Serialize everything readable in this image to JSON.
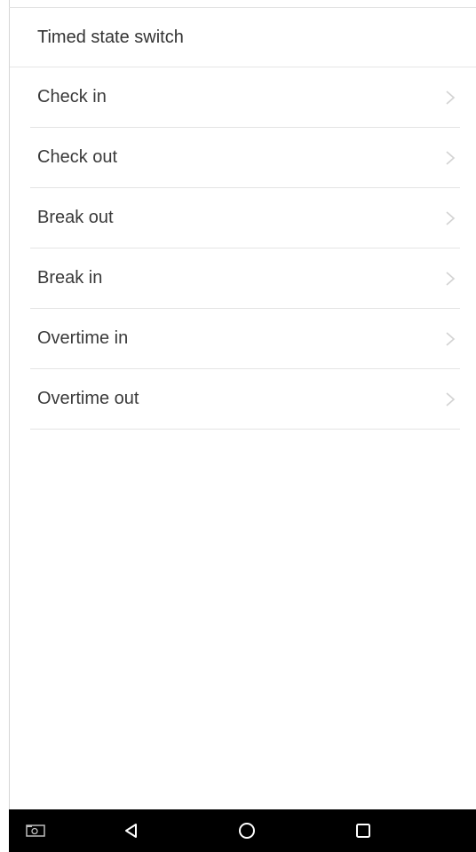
{
  "header": {
    "title": "Timed state switch"
  },
  "list": {
    "items": [
      {
        "label": "Check in",
        "icon": "chevron-right-icon"
      },
      {
        "label": "Check out",
        "icon": "chevron-right-icon"
      },
      {
        "label": "Break out",
        "icon": "chevron-right-icon"
      },
      {
        "label": "Break in",
        "icon": "chevron-right-icon"
      },
      {
        "label": "Overtime in",
        "icon": "chevron-right-icon"
      },
      {
        "label": "Overtime out",
        "icon": "chevron-right-icon"
      }
    ]
  },
  "navbar": {
    "buttons": [
      "screenshot-icon",
      "back-icon",
      "home-icon",
      "recents-icon"
    ],
    "background": "#000000",
    "icon_color": "#ffffff"
  }
}
